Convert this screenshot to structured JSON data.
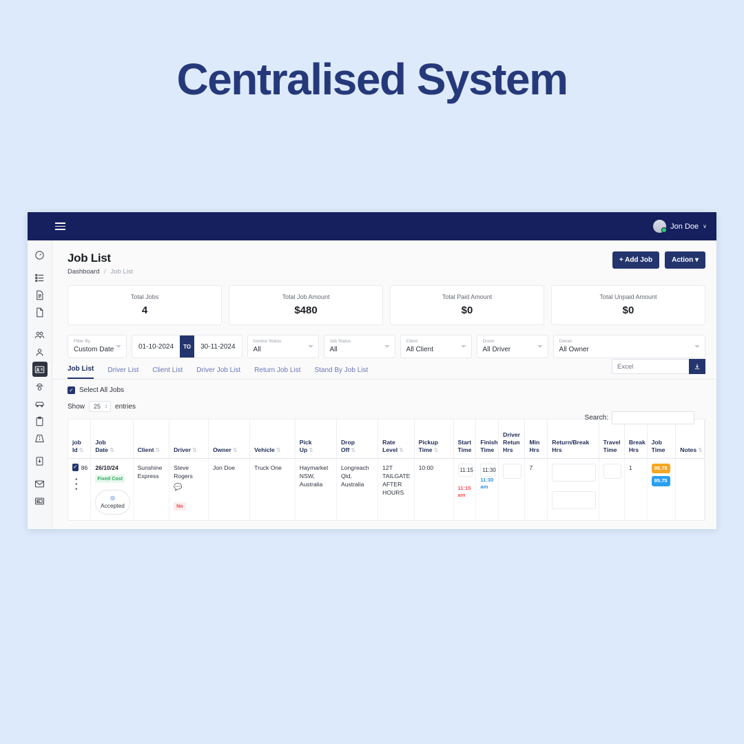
{
  "hero": {
    "title": "Centralised System"
  },
  "topbar": {
    "menu_icon": "hamburger-icon",
    "user_name": "Jon Doe",
    "caret": "∨"
  },
  "sidebar": {
    "items": [
      {
        "icon": "speedometer-icon",
        "active": false
      },
      {
        "icon": "list-icon",
        "active": false
      },
      {
        "icon": "document-icon",
        "active": false
      },
      {
        "icon": "file-icon",
        "active": false
      },
      {
        "icon": "people-icon",
        "active": false
      },
      {
        "icon": "person-icon",
        "active": false
      },
      {
        "icon": "id-card-icon",
        "active": true
      },
      {
        "icon": "driver-icon",
        "active": false
      },
      {
        "icon": "car-icon",
        "active": false
      },
      {
        "icon": "clipboard-icon",
        "active": false
      },
      {
        "icon": "road-icon",
        "active": false
      },
      {
        "icon": "download-box-icon",
        "active": false
      },
      {
        "icon": "envelope-icon",
        "active": false
      },
      {
        "icon": "mail-image-icon",
        "active": false
      }
    ]
  },
  "page": {
    "title": "Job List",
    "breadcrumb": {
      "root": "Dashboard",
      "sep": "/",
      "current": "Job List"
    },
    "add_job_label": "+ Add Job",
    "action_label": "Action ▾"
  },
  "stats": [
    {
      "label": "Total Jobs",
      "value": "4"
    },
    {
      "label": "Total Job Amount",
      "value": "$480"
    },
    {
      "label": "Total Paid Amount",
      "value": "$0"
    },
    {
      "label": "Total Unpaid Amount",
      "value": "$0"
    }
  ],
  "filters": {
    "filter_by": {
      "label": "Filter By",
      "value": "Custom Date"
    },
    "date_from": "01-10-2024",
    "date_to_label": "TO",
    "date_to": "30-11-2024",
    "invoice_status": {
      "label": "Invoice Status",
      "value": "All"
    },
    "job_status": {
      "label": "Job Status",
      "value": "All"
    },
    "client": {
      "label": "Client",
      "value": "All Client"
    },
    "driver": {
      "label": "Driver",
      "value": "All Driver"
    },
    "owner": {
      "label": "Owner",
      "value": "All Owner"
    }
  },
  "tabs": [
    {
      "label": "Job List",
      "active": true
    },
    {
      "label": "Driver List",
      "active": false
    },
    {
      "label": "Client List",
      "active": false
    },
    {
      "label": "Driver Job List",
      "active": false
    },
    {
      "label": "Return Job List",
      "active": false
    },
    {
      "label": "Stand By Job List",
      "active": false
    }
  ],
  "export": {
    "value": "Excel",
    "icon": "download-icon"
  },
  "controls": {
    "select_all_label": "Select All Jobs",
    "select_all_checked": true,
    "show_label": "Show",
    "show_value": "25",
    "entries_label": "entries",
    "search_label": "Search:",
    "search_value": ""
  },
  "table": {
    "columns": [
      {
        "line1": "job",
        "line2": "Id",
        "sort": "⇅"
      },
      {
        "line1": "Job",
        "line2": "Date",
        "sort": "⇅"
      },
      {
        "line1": "",
        "line2": "Client",
        "sort": "⇅"
      },
      {
        "line1": "",
        "line2": "Driver",
        "sort": "⇅"
      },
      {
        "line1": "",
        "line2": "Owner",
        "sort": "⇅"
      },
      {
        "line1": "",
        "line2": "Vehicle",
        "sort": "⇅"
      },
      {
        "line1": "Pick",
        "line2": "Up",
        "sort": "⇅"
      },
      {
        "line1": "Drop",
        "line2": "Off",
        "sort": "⇅"
      },
      {
        "line1": "Rate",
        "line2": "Level",
        "sort": "⇅"
      },
      {
        "line1": "Pickup",
        "line2": "Time",
        "sort": "⇅"
      },
      {
        "line1": "Start",
        "line2": "Time",
        "sort": ""
      },
      {
        "line1": "Finish",
        "line2": "Time",
        "sort": ""
      },
      {
        "line1": "Driver Retun",
        "line2": "Hrs",
        "sort": ""
      },
      {
        "line1": "Min",
        "line2": "Hrs",
        "sort": ""
      },
      {
        "line1": "Return/Break",
        "line2": "Hrs",
        "sort": ""
      },
      {
        "line1": "Travel",
        "line2": "Time",
        "sort": ""
      },
      {
        "line1": "Break",
        "line2": "Hrs",
        "sort": ""
      },
      {
        "line1": "Job",
        "line2": "Time",
        "sort": ""
      },
      {
        "line1": "",
        "line2": "Notes",
        "sort": "⇅"
      }
    ],
    "rows": [
      {
        "checked": true,
        "job_id": "86",
        "job_date": "26/10/24",
        "cost_badge": "Fixed Cost",
        "status_pill": "Accepted",
        "status_pill_icon": "◎",
        "client": "Sunshine Express",
        "driver": "Steve Rogers",
        "driver_chat_icon": "chat-icon",
        "driver_badge": "No",
        "owner": "Jon Doe",
        "vehicle": "Truck One",
        "pick_up": "Haymarket NSW, Australia",
        "drop_off": "Longreach Qld, Australia",
        "rate_level": "12T TAILGATE AFTER HOURS",
        "pickup_time": "10:00",
        "start_time": "11:15",
        "start_time_alt": "11:15 am",
        "finish_time": "11:30",
        "finish_time_alt": "11:30 am",
        "driver_return_hrs": "",
        "min_hrs": "7",
        "return_break_hrs_1": "",
        "return_break_hrs_2": "",
        "travel_time": "",
        "break_hrs": "1",
        "job_time_orange": "95.75",
        "job_time_blue": "95.75",
        "notes": ""
      }
    ]
  },
  "colors": {
    "brand_navy": "#24356e",
    "topbar_navy": "#16205e",
    "hero_title": "#25397a",
    "page_bg": "#ddeafb",
    "badge_orange": "#f5a623",
    "badge_blue": "#28a0f0",
    "badge_green": "#2eab5a",
    "badge_red": "#ee4b4b"
  }
}
